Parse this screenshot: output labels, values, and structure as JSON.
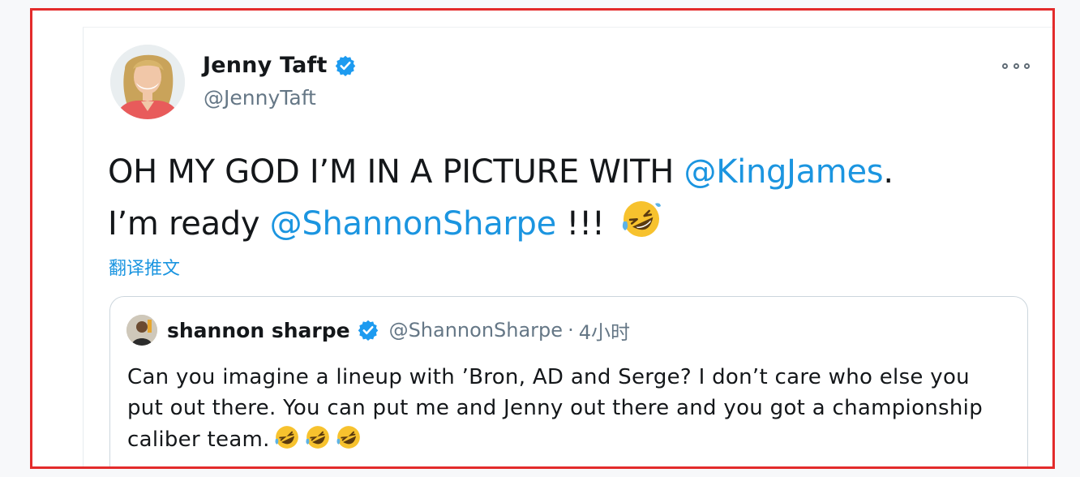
{
  "tweet": {
    "author_name": "Jenny Taft",
    "author_handle": "@JennyTaft",
    "verified_icon": "verified-badge-icon",
    "more_icon": "more-options-icon",
    "text_part1": "OH MY GOD I’M IN A PICTURE WITH ",
    "mention1": "@KingJames",
    "text_part2": ".",
    "text_part3": "I’m ready ",
    "mention2": "@ShannonSharpe",
    "text_part4": " !!! ",
    "emoji": "rolling-on-floor-laughing-emoji",
    "translate_label": "翻译推文"
  },
  "quoted_tweet": {
    "author_name": "shannon sharpe",
    "author_handle": "@ShannonSharpe",
    "separator": "·",
    "time": "4小时",
    "text": "Can you imagine a lineup with ’Bron, AD and Serge? I don’t care who else you put out there. You can put me and Jenny out there and you got a championship caliber team.",
    "emoji_count": 3
  },
  "colors": {
    "highlight_border": "#e32b2b",
    "link": "#1b95e0",
    "verified": "#1d9bf0",
    "secondary_text": "#657786"
  }
}
